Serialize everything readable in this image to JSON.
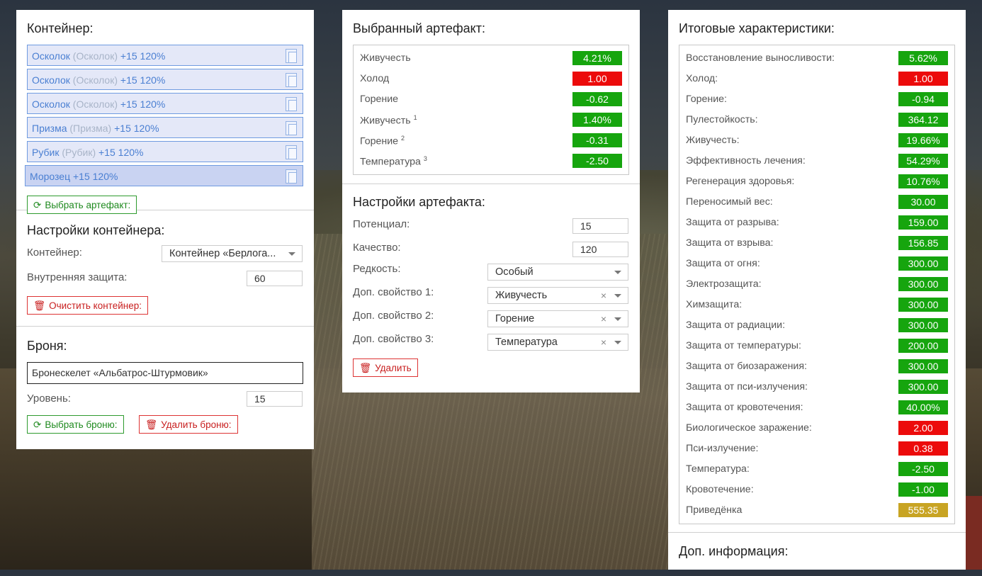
{
  "container": {
    "title": "Контейнер:",
    "slots": [
      {
        "name": "Осколок",
        "sub": "(Осколок)",
        "suffix": "+15 120%"
      },
      {
        "name": "Осколок",
        "sub": "(Осколок)",
        "suffix": "+15 120%"
      },
      {
        "name": "Осколок",
        "sub": "(Осколок)",
        "suffix": "+15 120%"
      },
      {
        "name": "Призма",
        "sub": "(Призма)",
        "suffix": "+15 120%"
      },
      {
        "name": "Рубик",
        "sub": "(Рубик)",
        "suffix": "+15 120%"
      },
      {
        "name": "Морозец",
        "sub": "",
        "suffix": "+15 120%"
      }
    ],
    "select_button": "Выбрать артефакт:"
  },
  "container_settings": {
    "title": "Настройки контейнера:",
    "container_label": "Контейнер:",
    "container_value": "Контейнер «Берлога...",
    "protection_label": "Внутренняя защита:",
    "protection_value": "60",
    "clear_button": "Очистить контейнер:"
  },
  "armor": {
    "title": "Броня:",
    "name": "Бронескелет «Альбатрос-Штурмовик»",
    "level_label": "Уровень:",
    "level_value": "15",
    "select_button": "Выбрать броню:",
    "delete_button": "Удалить броню:"
  },
  "selected": {
    "title": "Выбранный артефакт:",
    "stats": [
      {
        "label": "Живучесть",
        "sup": "",
        "value": "4.21%",
        "color": "g"
      },
      {
        "label": "Холод",
        "sup": "",
        "value": "1.00",
        "color": "r"
      },
      {
        "label": "Горение",
        "sup": "",
        "value": "-0.62",
        "color": "g"
      },
      {
        "label": "Живучесть",
        "sup": "1",
        "value": "1.40%",
        "color": "g"
      },
      {
        "label": "Горение",
        "sup": "2",
        "value": "-0.31",
        "color": "g"
      },
      {
        "label": "Температура",
        "sup": "3",
        "value": "-2.50",
        "color": "g"
      }
    ]
  },
  "artifact_settings": {
    "title": "Настройки артефакта:",
    "potential_label": "Потенциал:",
    "potential_value": "15",
    "quality_label": "Качество:",
    "quality_value": "120",
    "rarity_label": "Редкость:",
    "rarity_value": "Особый",
    "prop1_label": "Доп. свойство 1:",
    "prop1_value": "Живучесть",
    "prop2_label": "Доп. свойство 2:",
    "prop2_value": "Горение",
    "prop3_label": "Доп. свойство 3:",
    "prop3_value": "Температура",
    "clear_x": "×",
    "delete_button": "Удалить"
  },
  "totals": {
    "title": "Итоговые характеристики:",
    "stats": [
      {
        "label": "Восстановление выносливости:",
        "value": "5.62%",
        "color": "g"
      },
      {
        "label": "Холод:",
        "value": "1.00",
        "color": "r"
      },
      {
        "label": "Горение:",
        "value": "-0.94",
        "color": "g"
      },
      {
        "label": "Пулестойкость:",
        "value": "364.12",
        "color": "g"
      },
      {
        "label": "Живучесть:",
        "value": "19.66%",
        "color": "g"
      },
      {
        "label": "Эффективность лечения:",
        "value": "54.29%",
        "color": "g"
      },
      {
        "label": "Регенерация здоровья:",
        "value": "10.76%",
        "color": "g"
      },
      {
        "label": "Переносимый вес:",
        "value": "30.00",
        "color": "g"
      },
      {
        "label": "Защита от разрыва:",
        "value": "159.00",
        "color": "g"
      },
      {
        "label": "Защита от взрыва:",
        "value": "156.85",
        "color": "g"
      },
      {
        "label": "Защита от огня:",
        "value": "300.00",
        "color": "g"
      },
      {
        "label": "Электрозащита:",
        "value": "300.00",
        "color": "g"
      },
      {
        "label": "Химзащита:",
        "value": "300.00",
        "color": "g"
      },
      {
        "label": "Защита от радиации:",
        "value": "300.00",
        "color": "g"
      },
      {
        "label": "Защита от температуры:",
        "value": "200.00",
        "color": "g"
      },
      {
        "label": "Защита от биозаражения:",
        "value": "300.00",
        "color": "g"
      },
      {
        "label": "Защита от пси-излучения:",
        "value": "300.00",
        "color": "g"
      },
      {
        "label": "Защита от кровотечения:",
        "value": "40.00%",
        "color": "g"
      },
      {
        "label": "Биологическое заражение:",
        "value": "2.00",
        "color": "r"
      },
      {
        "label": "Пси-излучение:",
        "value": "0.38",
        "color": "r"
      },
      {
        "label": "Температура:",
        "value": "-2.50",
        "color": "g"
      },
      {
        "label": "Кровотечение:",
        "value": "-1.00",
        "color": "g"
      },
      {
        "label": "Приведёнка",
        "value": "555.35",
        "color": "y"
      }
    ]
  },
  "extra": {
    "title": "Доп. информация:"
  },
  "colors": {
    "green": "#16a50e",
    "red": "#ec0b0b",
    "yellow": "#c8a423",
    "slot_border": "#6f9be0",
    "slot_text": "#4a7fd2"
  }
}
